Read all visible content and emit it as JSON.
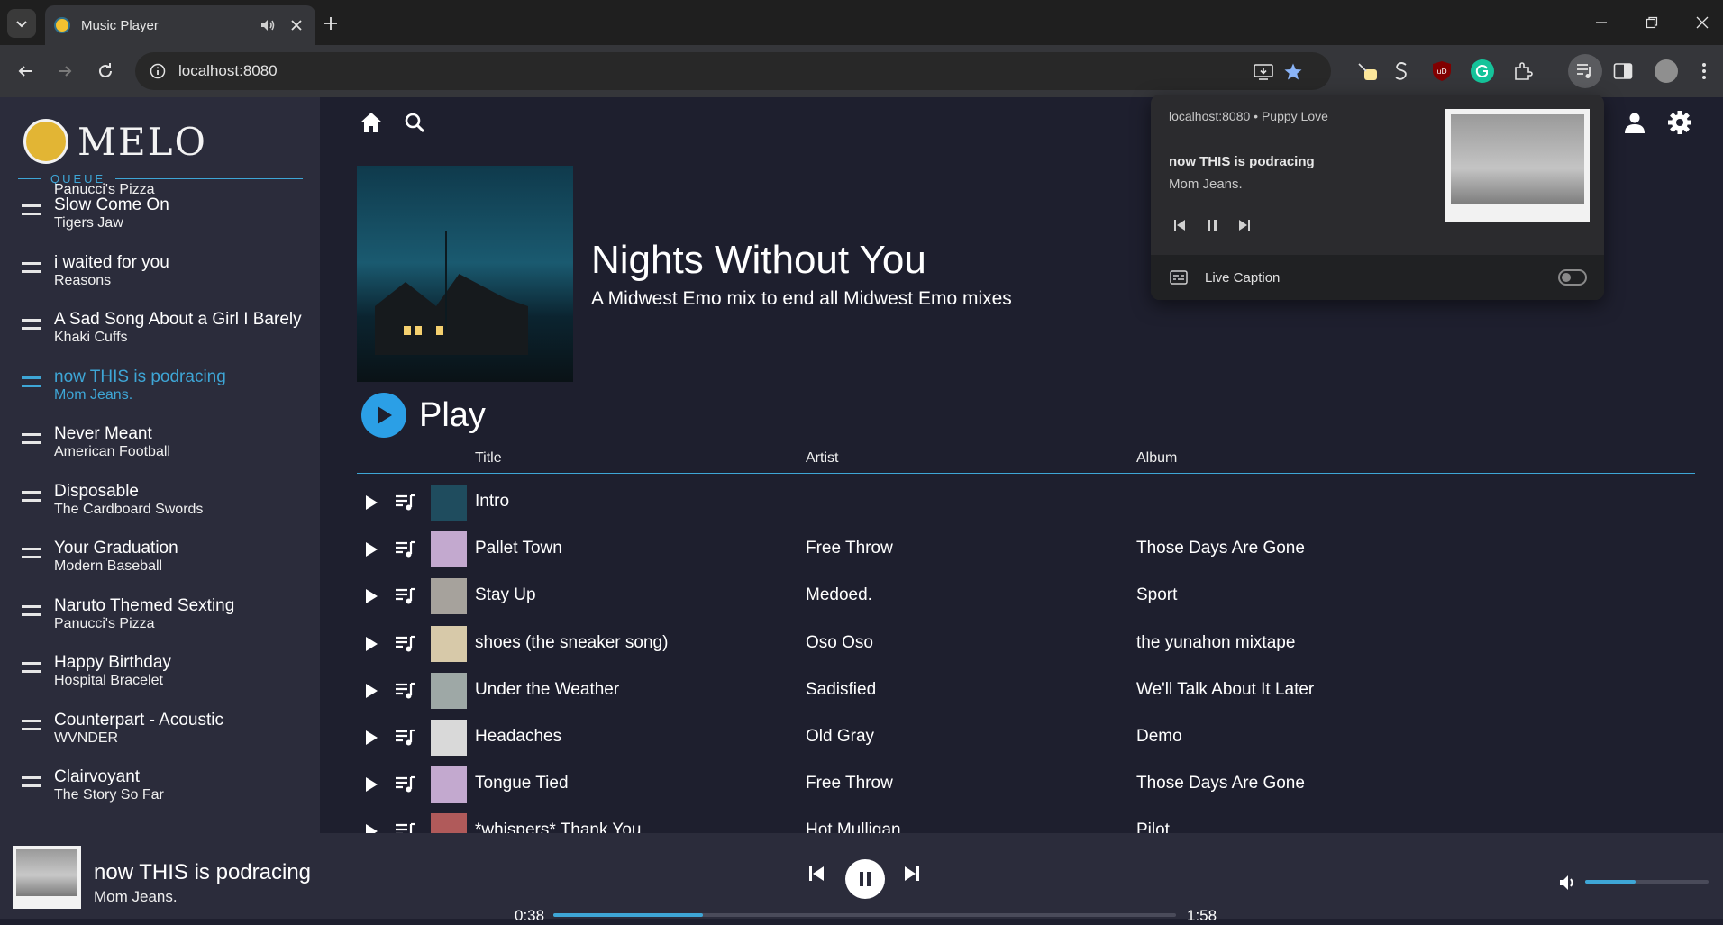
{
  "browser": {
    "tab_title": "Music Player",
    "url": "localhost:8080"
  },
  "app": {
    "logo_text": "MELO",
    "queue_label": "QUEUE"
  },
  "queue": [
    {
      "title": "",
      "artist": "Panucci's Pizza"
    },
    {
      "title": "Slow Come On",
      "artist": "Tigers Jaw"
    },
    {
      "title": "i waited for you",
      "artist": "Reasons"
    },
    {
      "title": "A Sad Song About a Girl I Barely Knew",
      "artist": "Khaki Cuffs"
    },
    {
      "title": "now THIS is podracing",
      "artist": "Mom Jeans.",
      "active": true
    },
    {
      "title": "Never Meant",
      "artist": "American Football"
    },
    {
      "title": "Disposable",
      "artist": "The Cardboard Swords"
    },
    {
      "title": "Your Graduation",
      "artist": "Modern Baseball"
    },
    {
      "title": "Naruto Themed Sexting",
      "artist": "Panucci's Pizza"
    },
    {
      "title": "Happy Birthday",
      "artist": "Hospital Bracelet"
    },
    {
      "title": "Counterpart - Acoustic",
      "artist": "WVNDER"
    },
    {
      "title": "Clairvoyant",
      "artist": "The Story So Far"
    }
  ],
  "playlist": {
    "title": "Nights Without You",
    "subtitle": "A Midwest Emo mix to end all Midwest Emo mixes",
    "play_label": "Play",
    "columns": {
      "title": "Title",
      "artist": "Artist",
      "album": "Album"
    },
    "tracks": [
      {
        "title": "Intro",
        "artist": "",
        "album": "",
        "thumb": "#1f4c5e"
      },
      {
        "title": "Pallet Town",
        "artist": "Free Throw",
        "album": "Those Days Are Gone",
        "thumb": "#c3a9cf"
      },
      {
        "title": "Stay Up",
        "artist": "Medoed.",
        "album": "Sport",
        "thumb": "#a6a29c"
      },
      {
        "title": "shoes (the sneaker song)",
        "artist": "Oso Oso",
        "album": "the yunahon mixtape",
        "thumb": "#d7c9a9"
      },
      {
        "title": "Under the Weather",
        "artist": "Sadisfied",
        "album": "We'll Talk About It Later",
        "thumb": "#9ea8a6"
      },
      {
        "title": "Headaches",
        "artist": "Old Gray",
        "album": "Demo",
        "thumb": "#d9d9d9"
      },
      {
        "title": "Tongue Tied",
        "artist": "Free Throw",
        "album": "Those Days Are Gone",
        "thumb": "#c3a9cf"
      },
      {
        "title": "*whispers* Thank You",
        "artist": "Hot Mulligan",
        "album": "Pilot",
        "thumb": "#b05a5a"
      }
    ]
  },
  "media_popup": {
    "source": "localhost:8080  •  Puppy Love",
    "title": "now THIS is podracing",
    "artist": "Mom Jeans.",
    "caption_label": "Live Caption"
  },
  "player": {
    "title": "now THIS is podracing",
    "artist": "Mom Jeans.",
    "elapsed": "0:38",
    "duration": "1:58",
    "progress_fraction": 0.24,
    "volume_fraction": 0.41
  },
  "colors": {
    "accent": "#3ea6d6",
    "play_button": "#2b9fe6"
  }
}
